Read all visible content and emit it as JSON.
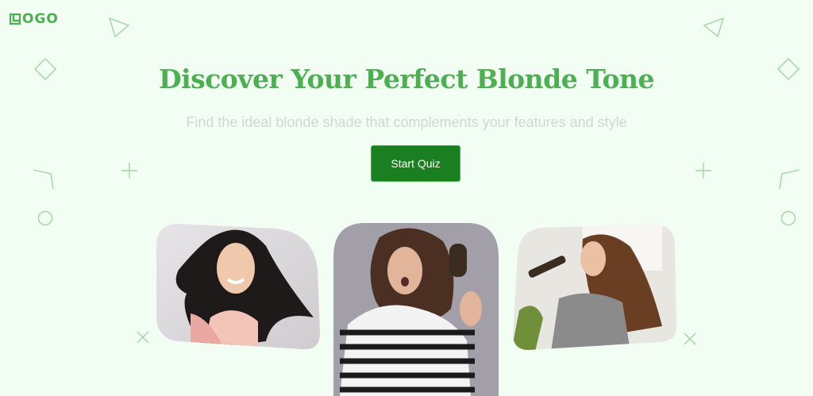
{
  "header": {
    "logo_text": "OGO"
  },
  "hero": {
    "title": "Discover Your Perfect Blonde Tone",
    "subtitle": "Find the ideal blonde shade that complements your features and style",
    "cta_label": "Start Quiz"
  },
  "photos": [
    {
      "name": "smiling-woman-photo"
    },
    {
      "name": "frustrated-woman-photo"
    },
    {
      "name": "brushing-hair-woman-photo"
    }
  ],
  "colors": {
    "accent": "#4caf50",
    "button": "#1a7f21",
    "background": "#f2fdf3",
    "subtitle": "#d2d6d3"
  }
}
